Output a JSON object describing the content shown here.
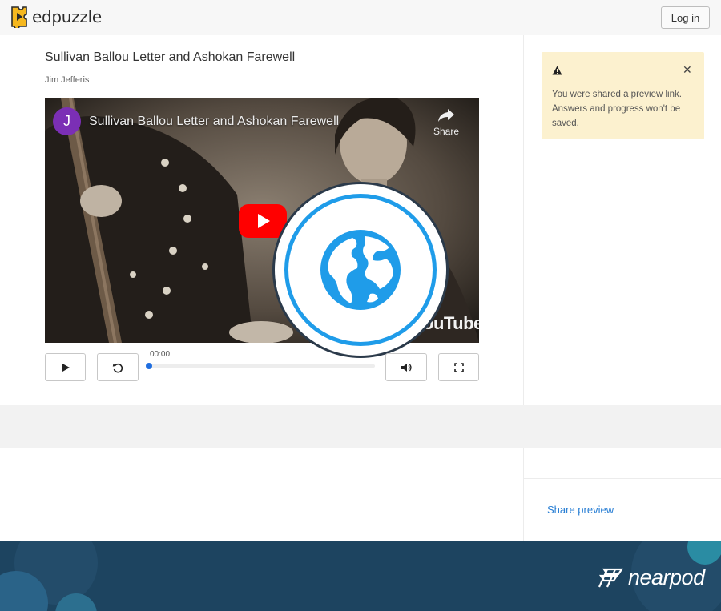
{
  "header": {
    "brand": "edpuzzle",
    "login_label": "Log in"
  },
  "video": {
    "title": "Sullivan Ballou Letter and Ashokan Farewell",
    "author": "Jim Jefferis",
    "embed": {
      "channel_initial": "J",
      "overlay_title": "Sullivan Ballou Letter and Ashokan Farewell",
      "share_label": "Share",
      "brand_watermark": "ouTube",
      "play_icon": "youtube-play-icon"
    },
    "overlay_badge_icon": "globe-icon"
  },
  "controls": {
    "time": "00:00",
    "progress": 0,
    "icons": [
      "play-icon",
      "replay-icon",
      "volume-icon",
      "fullscreen-icon"
    ]
  },
  "notice": {
    "icon": "warning-icon",
    "text": "You were shared a preview link. Answers and progress won't be saved.",
    "close_icon": "close-icon"
  },
  "sidebar": {
    "share_preview_label": "Share preview"
  },
  "footer": {
    "brand": "nearpod"
  },
  "colors": {
    "accent": "#1f9ce9",
    "link": "#2a7fd4",
    "notice_bg": "#fcf1cf",
    "footer_bg": "#1d4460",
    "youtube_red": "#ff0000"
  }
}
